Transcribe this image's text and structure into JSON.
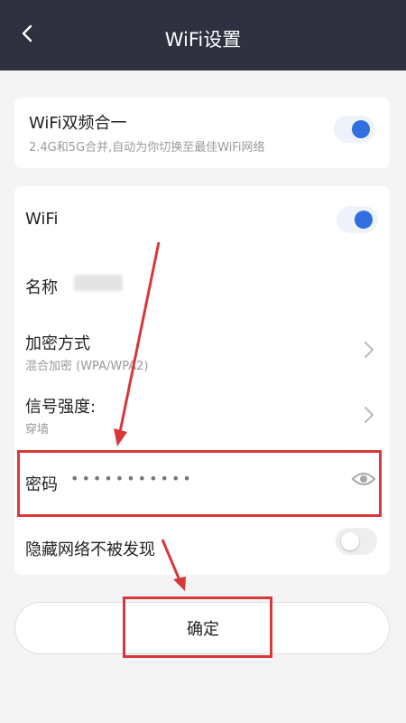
{
  "header": {
    "title": "WiFi设置"
  },
  "dual_band": {
    "title": "WiFi双频合一",
    "subtitle": "2.4G和5G合并,自动为你切换至最佳WiFi网络",
    "enabled": true
  },
  "wifi": {
    "label": "WiFi",
    "enabled": true
  },
  "name": {
    "label": "名称"
  },
  "encryption": {
    "label": "加密方式",
    "value": "混合加密 (WPA/WPA2)"
  },
  "signal": {
    "label": "信号强度:",
    "value": "穿墙"
  },
  "password": {
    "label": "密码",
    "masked_value": "•••••••••••"
  },
  "hide_network": {
    "label": "隐藏网络不被发现",
    "enabled": false
  },
  "confirm_button": {
    "label": "确定"
  },
  "colors": {
    "header_bg": "#2f3140",
    "accent": "#2f6fe0",
    "annotation": "#d8383a"
  }
}
